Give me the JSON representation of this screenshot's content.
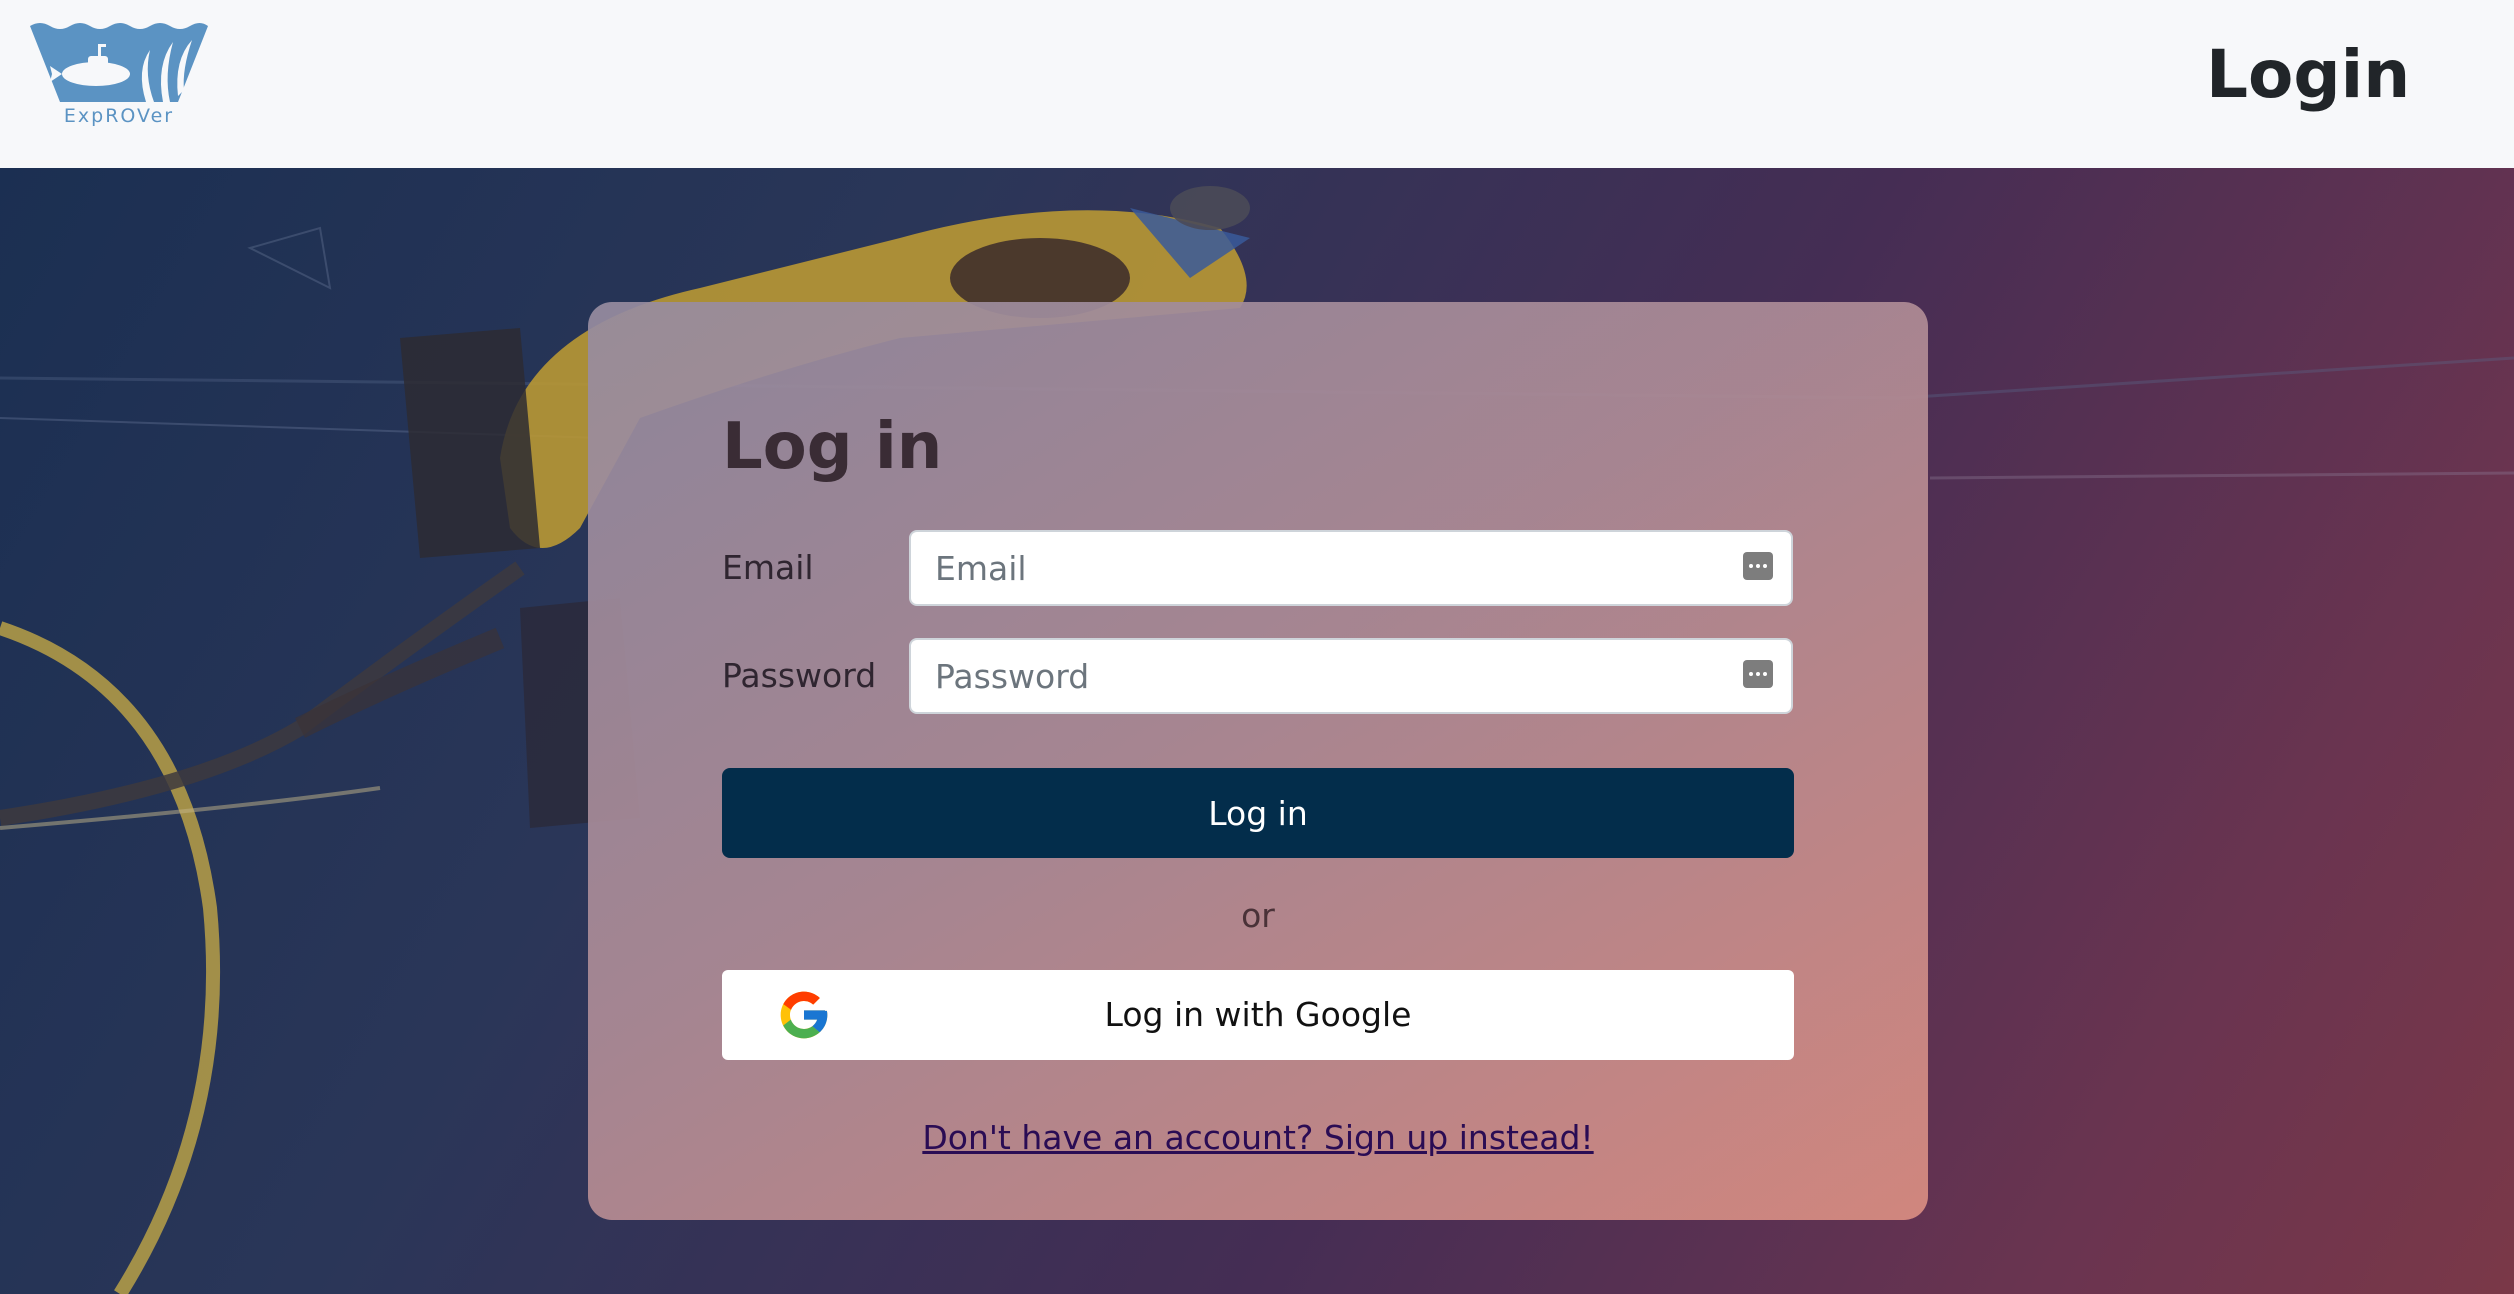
{
  "brand": {
    "name": "ExpROVer",
    "logo_icon": "submarine-logo-icon"
  },
  "header": {
    "title": "Login"
  },
  "login_form": {
    "heading": "Log in",
    "email_label": "Email",
    "email_placeholder": "Email",
    "email_value": "",
    "password_label": "Password",
    "password_placeholder": "Password",
    "password_value": "",
    "password_manager_icon": "password-manager-key-icon",
    "submit_label": "Log in",
    "separator": "or",
    "google_label": "Log in with Google",
    "google_icon": "google-logo-icon",
    "signup_link": "Don't have an account? Sign up instead!"
  },
  "colors": {
    "primary_button": "#032d4b",
    "link": "#2a0c54",
    "navbar_bg": "#f7f8fa",
    "logo_blue": "#5b93c3"
  }
}
